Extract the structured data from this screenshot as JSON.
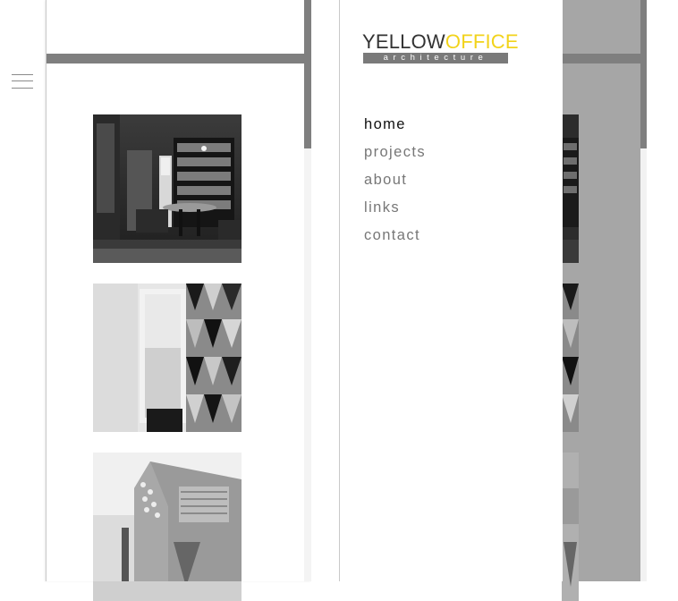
{
  "brand": {
    "name_part1": "YELLOW",
    "name_part2": "OFFICE",
    "tagline": "architecture",
    "colors": {
      "yellow": "#f2d31b",
      "dark": "#333333",
      "tagline_bg": "#7a7a7a"
    }
  },
  "header": {
    "menu_icon": "hamburger-menu-icon"
  },
  "nav": {
    "items": [
      {
        "label": "home",
        "active": true
      },
      {
        "label": "projects",
        "active": false
      },
      {
        "label": "about",
        "active": false
      },
      {
        "label": "links",
        "active": false
      },
      {
        "label": "contact",
        "active": false
      }
    ]
  },
  "gallery": {
    "items": [
      {
        "name": "project-thumbnail-library"
      },
      {
        "name": "project-thumbnail-window-wall"
      },
      {
        "name": "project-thumbnail-building-exterior"
      }
    ]
  },
  "colors": {
    "bar_grey": "#7f7f7f",
    "overlay_grey": "#a6a6a6",
    "nav_text": "#777777",
    "nav_active": "#111111"
  }
}
